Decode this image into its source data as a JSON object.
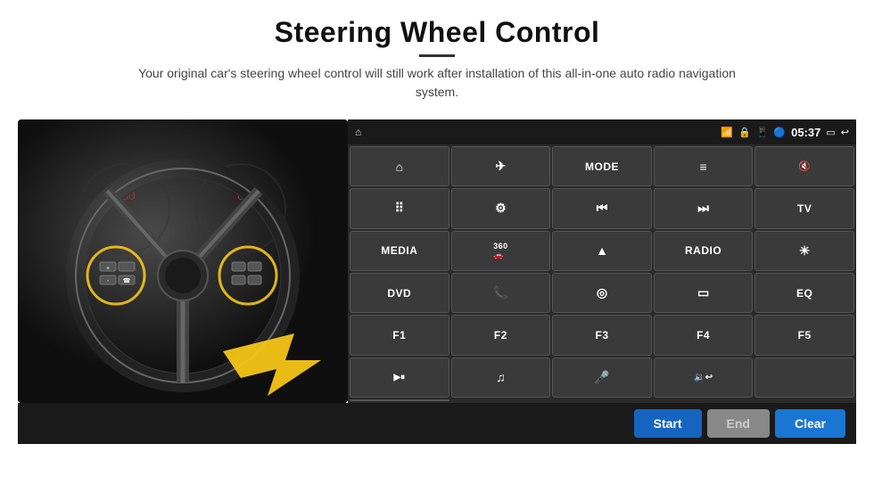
{
  "page": {
    "title": "Steering Wheel Control",
    "subtitle": "Your original car's steering wheel control will still work after installation of this all-in-one auto radio navigation system."
  },
  "status_bar": {
    "time": "05:37",
    "icons": [
      "wifi",
      "lock",
      "sim",
      "bluetooth",
      "cast",
      "back"
    ]
  },
  "buttons": [
    {
      "id": "r1c1",
      "icon": "⌂",
      "label": "home"
    },
    {
      "id": "r1c2",
      "icon": "✈",
      "label": "navigate"
    },
    {
      "id": "r1c3",
      "text": "MODE",
      "label": "mode"
    },
    {
      "id": "r1c4",
      "icon": "≡",
      "label": "menu"
    },
    {
      "id": "r1c5",
      "icon": "🔇",
      "label": "mute"
    },
    {
      "id": "r1c6",
      "icon": "⠿",
      "label": "apps"
    },
    {
      "id": "r2c1",
      "icon": "⚙",
      "label": "settings"
    },
    {
      "id": "r2c2",
      "icon": "⏮",
      "label": "prev"
    },
    {
      "id": "r2c3",
      "icon": "⏭",
      "label": "next"
    },
    {
      "id": "r2c4",
      "text": "TV",
      "label": "tv"
    },
    {
      "id": "r2c5",
      "text": "MEDIA",
      "label": "media"
    },
    {
      "id": "r3c1",
      "icon": "360",
      "label": "camera360"
    },
    {
      "id": "r3c2",
      "icon": "▲",
      "label": "eject"
    },
    {
      "id": "r3c3",
      "text": "RADIO",
      "label": "radio"
    },
    {
      "id": "r3c4",
      "icon": "☀",
      "label": "brightness"
    },
    {
      "id": "r3c5",
      "text": "DVD",
      "label": "dvd"
    },
    {
      "id": "r4c1",
      "icon": "📞",
      "label": "phone"
    },
    {
      "id": "r4c2",
      "icon": "◎",
      "label": "nav2"
    },
    {
      "id": "r4c3",
      "icon": "▭",
      "label": "screen"
    },
    {
      "id": "r4c4",
      "text": "EQ",
      "label": "eq"
    },
    {
      "id": "r4c5",
      "text": "F1",
      "label": "f1"
    },
    {
      "id": "r5c1",
      "text": "F2",
      "label": "f2"
    },
    {
      "id": "r5c2",
      "text": "F3",
      "label": "f3"
    },
    {
      "id": "r5c3",
      "text": "F4",
      "label": "f4"
    },
    {
      "id": "r5c4",
      "text": "F5",
      "label": "f5"
    },
    {
      "id": "r5c5",
      "icon": "▶⏸",
      "label": "playpause"
    },
    {
      "id": "r6c1",
      "icon": "♫",
      "label": "music"
    },
    {
      "id": "r6c2",
      "icon": "🎤",
      "label": "mic"
    },
    {
      "id": "r6c3",
      "icon": "🔉",
      "label": "volphone"
    },
    {
      "id": "r6c4",
      "text": "",
      "label": "empty1"
    },
    {
      "id": "r6c5",
      "text": "",
      "label": "empty2"
    }
  ],
  "action_buttons": {
    "start": "Start",
    "end": "End",
    "clear": "Clear"
  },
  "colors": {
    "panel_bg": "#2a2a2a",
    "btn_bg": "#3a3a3a",
    "start_color": "#1565c0",
    "end_color": "#888888",
    "clear_color": "#1976d2"
  }
}
